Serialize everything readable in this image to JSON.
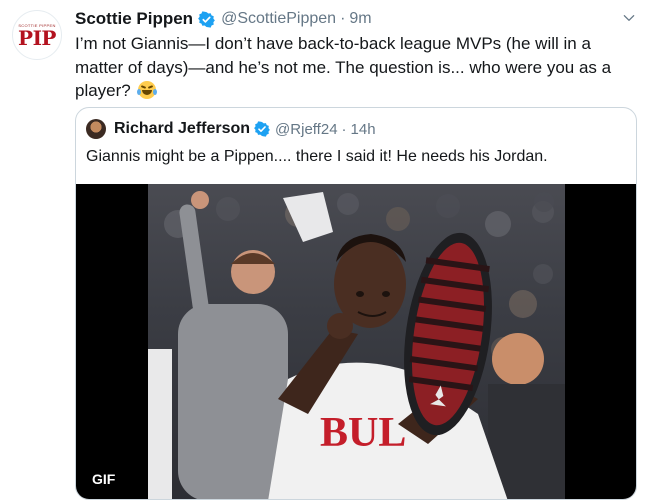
{
  "tweet": {
    "avatar_text": "PIP",
    "avatar_small_text": "SCOTTIE PIPPEN",
    "author_name": "Scottie Pippen",
    "handle": "@ScottiePippen",
    "separator": "·",
    "time": "9m",
    "text": "I’m not Giannis—I don’t have back-to-back league MVPs (he will in a matter of days)—and he’s not me. The question is... who were you as a player?",
    "emoji": "tears-of-joy-emoji",
    "menu_icon": "chevron-down-icon"
  },
  "quoted_tweet": {
    "author_name": "Richard Jefferson",
    "handle": "@Rjeff24",
    "separator": "·",
    "time": "14h",
    "text": "Giannis might be a Pippen.... there I said it! He needs his Jordan.",
    "media": {
      "badge": "GIF",
      "jersey_text": "BUL"
    }
  },
  "colors": {
    "verified": "#1da1f2",
    "secondary_text": "#657786",
    "border": "#ccd6dd",
    "brand_red": "#b3121f"
  }
}
